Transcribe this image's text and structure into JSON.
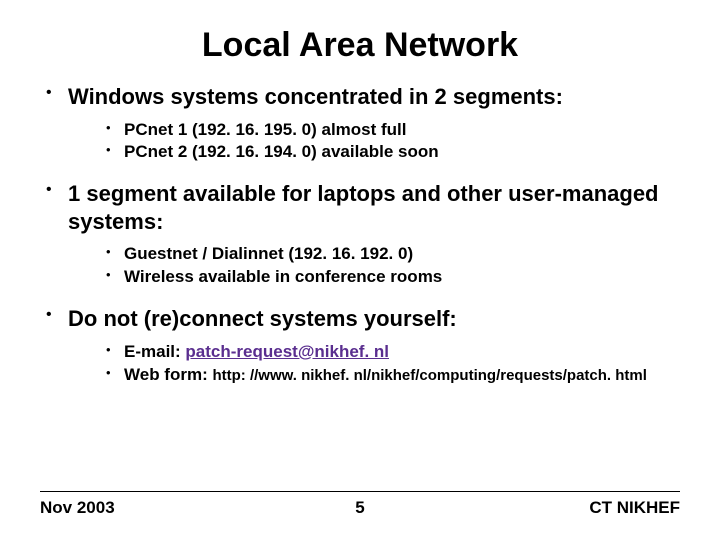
{
  "title": "Local Area Network",
  "bullets": {
    "b1": "Windows systems concentrated in 2 segments:",
    "b1a": "PCnet 1 (192. 16. 195. 0) almost full",
    "b1b": "PCnet 2 (192. 16. 194. 0) available soon",
    "b2": "1 segment available for laptops and other user-managed systems:",
    "b2a": "Guestnet / Dialinnet (192. 16. 192. 0)",
    "b2b": "Wireless available in conference rooms",
    "b3": "Do not (re)connect systems yourself:",
    "b3a_prefix": "E-mail: ",
    "b3a_link": "patch-request@nikhef. nl",
    "b3b_prefix": "Web form: ",
    "b3b_url": "http: //www. nikhef. nl/nikhef/computing/requests/patch. html"
  },
  "footer": {
    "left": "Nov 2003",
    "center": "5",
    "right": "CT NIKHEF"
  },
  "colors": {
    "link": "#5a2e8f"
  }
}
